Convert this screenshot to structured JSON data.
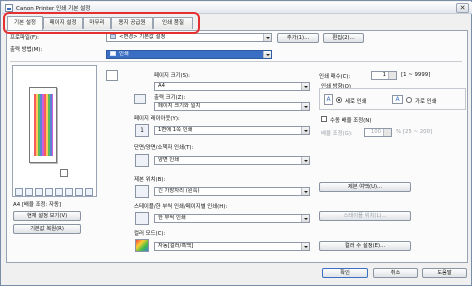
{
  "window": {
    "title": "Canon Printer 인쇄 기본 설정",
    "close_glyph": "✕"
  },
  "tabs": [
    "기본 설정",
    "페이지 설정",
    "마무리",
    "용지 공급원",
    "인쇄 품질"
  ],
  "profile": {
    "label": "프로파일(F):",
    "value": "<변경> 기본값 설정",
    "add_btn": "추가(1)...",
    "edit_btn": "편집(2)..."
  },
  "output": {
    "label": "출력 방법(M):",
    "value": "인쇄"
  },
  "preview": {
    "status": "A4 [배율 조정: 자동]",
    "view_btn": "현재 설정 보기(V)",
    "restore_btn": "기본값 복원(R)"
  },
  "page_size": {
    "label": "페이지 크기(S):",
    "value": "A4"
  },
  "output_size": {
    "label": "출력 크기(Z):",
    "value": "페이지 크기와 일치"
  },
  "layout": {
    "label": "페이지 레이아웃(Y):",
    "value": "1면에 1쪽 인쇄"
  },
  "duplex": {
    "label": "단면/양면/소책자 인쇄(T):",
    "value": "양면 인쇄"
  },
  "binding": {
    "label": "제본 위치(B):",
    "value": "긴 가장자리 (왼쪽)",
    "btn": "제본 여백(U)..."
  },
  "staple": {
    "label": "스테이플/한 부씩 인쇄/페이지별 인쇄(H):",
    "value": "한 부씩 인쇄",
    "btn": "스테이플 위치(L)..."
  },
  "color": {
    "label": "컬러 모드(C):",
    "value": "자동[컬러/흑백]",
    "btn": "컬러 수 설정(E)..."
  },
  "copies": {
    "label": "인쇄 매수(C):",
    "value": "1",
    "range": "[1 ~ 9999]"
  },
  "orientation": {
    "label": "인쇄 방향(O)",
    "portrait": "세로 인쇄",
    "landscape": "가로 인쇄"
  },
  "manual_scale": {
    "label": "수동 배율 조정(N)",
    "scale_label": "배율 조정(G):",
    "value": "100",
    "range": "% [25 ~ 200]"
  },
  "footer": {
    "ok": "확인",
    "cancel": "취소",
    "help": "도움말"
  },
  "colors": {
    "highlight": "#e53030",
    "selected": "#3a6fc4"
  }
}
